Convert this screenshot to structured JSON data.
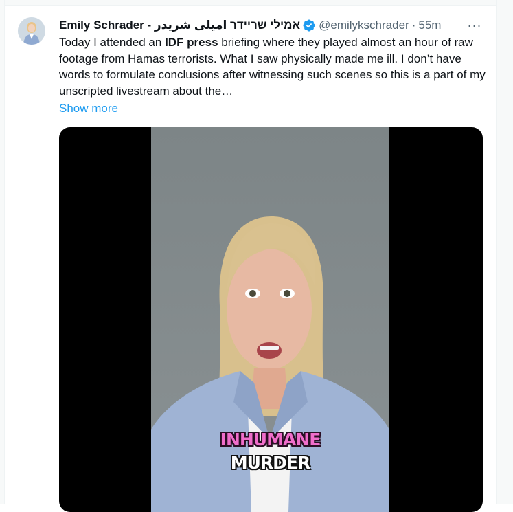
{
  "tweet": {
    "author_name": "Emily Schrader - אמילי שריידר امیلی شریدر",
    "handle": "@emilykschrader",
    "separator": "·",
    "time": "55m",
    "more_label": "···",
    "text_parts": [
      "Today I attended an ",
      "IDF press",
      " briefing where they played almost an hour of raw footage from Hamas terrorists. What I saw physically made me ill. I don’t have words to formulate conclusions after witnessing such scenes so this is a part of my unscripted livestream about the…"
    ],
    "show_more": "Show more",
    "video_captions": [
      "INHUMANE",
      "MURDER"
    ]
  },
  "icons": {
    "avatar": "profile-avatar",
    "verified": "verified-badge-icon",
    "more": "more-options-icon"
  },
  "colors": {
    "link": "#1d9bf0",
    "verified": "#1d9bf0",
    "muted": "#536471",
    "caption_pink": "#f06ecb"
  }
}
